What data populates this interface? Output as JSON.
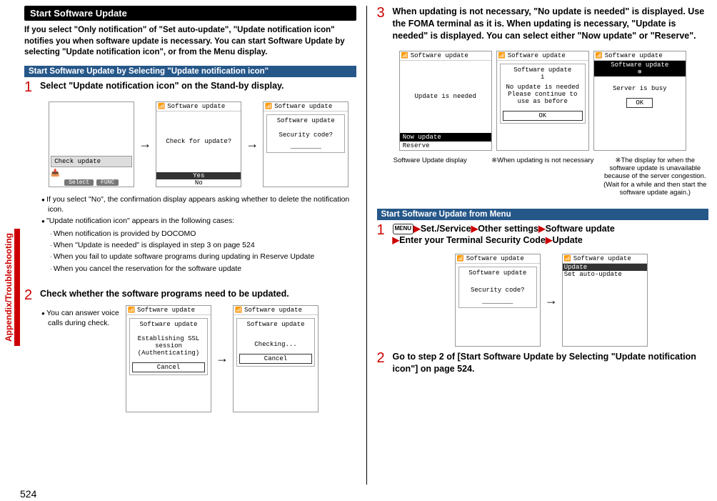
{
  "page_number": "524",
  "side_tab": "Appendix/Troubleshooting",
  "left": {
    "header": "Start Software Update",
    "intro": "If you select \"Only notification\" of \"Set auto-update\", \"Update notification icon\" notifies you when software update is necessary. You can start Software Update by selecting \"Update notification icon\", or from the Menu display.",
    "sub1": "Start Software Update by Selecting \"Update notification icon\"",
    "step1_num": "1",
    "step1_text": "Select \"Update notification icon\" on the Stand-by display.",
    "screens1": {
      "a_title": "",
      "a_body1": "Check update",
      "a_sk1": "Select",
      "a_sk2": "FUNC",
      "b_title": "Software update",
      "b_body": "Check for update?",
      "b_yes": "Yes",
      "b_no": "No",
      "c_title": "Software update",
      "c_sub": "Software update",
      "c_body": "Security code?",
      "c_line": "________"
    },
    "bullets1": [
      "If you select \"No\", the confirmation display appears asking whether to delete the notification icon.",
      "\"Update notification icon\" appears in the following cases:"
    ],
    "subbullets1": [
      "When notification is provided by DOCOMO",
      "When \"Update is needed\" is displayed in step 3 on page 524",
      "When you fail to update software programs during updating in Reserve Update",
      "When you cancel the reservation for the software update"
    ],
    "step2_num": "2",
    "step2_text": "Check whether the software programs need to be updated.",
    "note2": "You can answer voice calls during check.",
    "screens2": {
      "a_title": "Software update",
      "a_sub": "Software update",
      "a_body": "Establishing SSL session (Authenticating)",
      "a_btn": "Cancel",
      "b_title": "Software update",
      "b_sub": "Software update",
      "b_body": "Checking...",
      "b_btn": "Cancel"
    }
  },
  "right": {
    "step3_num": "3",
    "step3_text": "When updating is not necessary, \"No update is needed\" is displayed. Use the FOMA terminal as it is. When updating is necessary, \"Update is needed\" is displayed. You can select either \"Now update\" or \"Reserve\".",
    "screens3": {
      "a_title": "Software update",
      "a_body": "Update is needed",
      "a_nav1": "Now update",
      "a_nav2": "Reserve",
      "b_title": "Software update",
      "b_sub": "Software update\ni",
      "b_body": "No update is needed\nPlease continue to use as before",
      "b_btn": "OK",
      "c_title": "Software update",
      "c_sub": "Software update",
      "c_mark": "⊗",
      "c_body": "Server is busy",
      "c_btn": "OK"
    },
    "captions": {
      "a": "Software Update display",
      "b": "※When updating is not necessary",
      "c": "※The display for when the software update is unavailable because of the server congestion. (Wait for a while and then start the software update again.)"
    },
    "sub2": "Start Software Update from Menu",
    "step1_num": "1",
    "step1_menu": "MENU",
    "step1_items": [
      "Set./Service",
      "Other settings",
      "Software update",
      "Enter your Terminal Security Code",
      "Update"
    ],
    "screensM": {
      "a_title": "Software update",
      "a_sub": "Software update",
      "a_body": "Security code?",
      "a_line": "________",
      "b_title": "Software update",
      "b_opt1": "Update",
      "b_opt2": "Set auto-update"
    },
    "step2_num": "2",
    "step2_text": "Go to step 2 of [Start Software Update by Selecting \"Update notification icon\"] on page 524."
  }
}
